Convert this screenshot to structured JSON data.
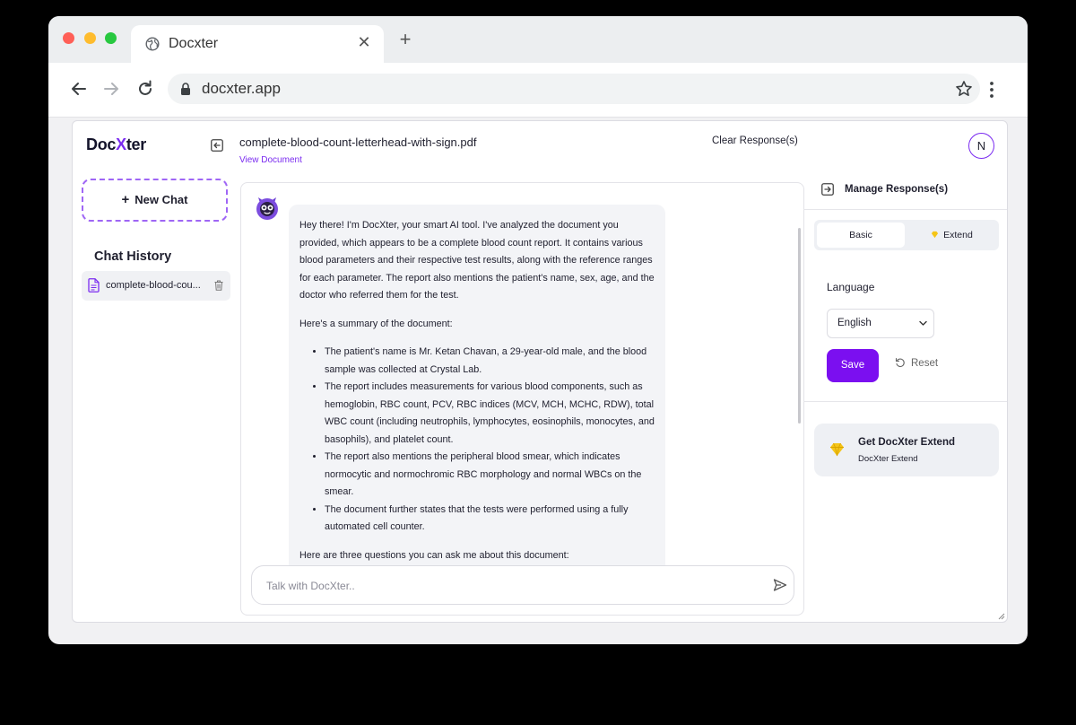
{
  "browser": {
    "tab_title": "Docxter",
    "tab_close": "✕",
    "new_tab": "+",
    "url": "docxter.app"
  },
  "app": {
    "logo_prefix": "Doc",
    "logo_x": "X",
    "logo_suffix": "ter",
    "document_title": "complete-blood-count-letterhead-with-sign.pdf",
    "view_document": "View Document",
    "clear_responses": "Clear Response(s)",
    "avatar_initial": "N"
  },
  "sidebar": {
    "new_chat_label": "New Chat",
    "new_chat_icon": "+",
    "history_title": "Chat History",
    "history_items": [
      {
        "label": "complete-blood-cou..."
      }
    ]
  },
  "chat": {
    "message": {
      "intro": "Hey there! I'm DocXter, your smart AI tool. I've analyzed the document you provided, which appears to be a complete blood count report. It contains various blood parameters and their respective test results, along with the reference ranges for each parameter. The report also mentions the patient's name, sex, age, and the doctor who referred them for the test.",
      "summary_heading": "Here's a summary of the document:",
      "bullets": [
        "The patient's name is Mr. Ketan Chavan, a 29-year-old male, and the blood sample was collected at Crystal Lab.",
        "The report includes measurements for various blood components, such as hemoglobin, RBC count, PCV, RBC indices (MCV, MCH, MCHC, RDW), total WBC count (including neutrophils, lymphocytes, eosinophils, monocytes, and basophils), and platelet count.",
        "The report also mentions the peripheral blood smear, which indicates normocytic and normochromic RBC morphology and normal WBCs on the smear.",
        "The document further states that the tests were performed using a fully automated cell counter."
      ],
      "questions_heading": "Here are three questions you can ask me about this document:"
    },
    "input_placeholder": "Talk with DocXter.."
  },
  "responses_panel": {
    "title": "Manage Response(s)",
    "tabs": {
      "basic": "Basic",
      "extend": "Extend"
    },
    "language_label": "Language",
    "language_value": "English",
    "save_label": "Save",
    "reset_label": "Reset",
    "promo_title": "Get DocXter Extend",
    "promo_subtitle": "DocXter Extend"
  },
  "colors": {
    "accent": "#7b0ff0",
    "gem": "#f5c518"
  }
}
